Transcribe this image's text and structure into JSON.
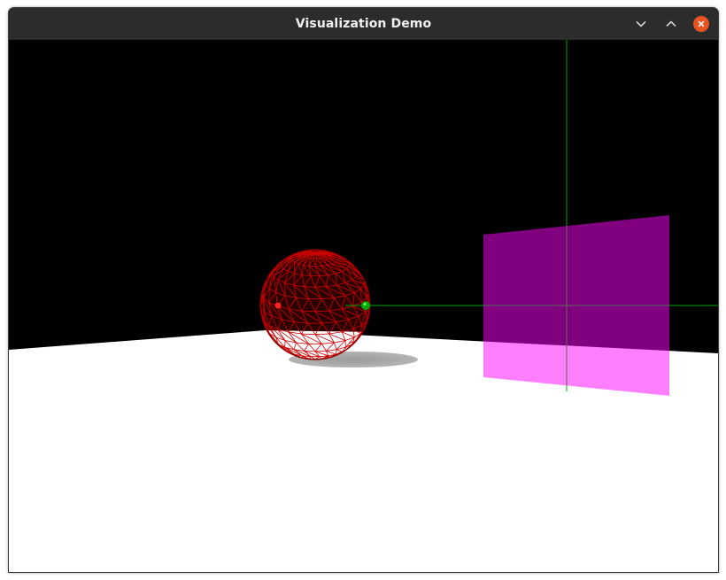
{
  "window": {
    "title": "Visualization Demo",
    "controls": {
      "minimize_icon": "chevron-down-icon",
      "maximize_icon": "chevron-up-icon",
      "close_icon": "close-circle-icon"
    },
    "colors": {
      "titlebar": "#2c2c2c",
      "title_text": "#f2f2f2",
      "close_button": "#e95420"
    }
  },
  "scene": {
    "background_color": "#000000",
    "floor_color": "#ffffff",
    "sphere": {
      "render_mode": "wireframe",
      "color": "#cc0000",
      "shadow_color": "#a0a0a0"
    },
    "marker_point": {
      "color": "#00bb00"
    },
    "plane": {
      "color": "#ff00ff",
      "opacity": 0.5
    },
    "axis_lines_color": "#00aa00"
  }
}
